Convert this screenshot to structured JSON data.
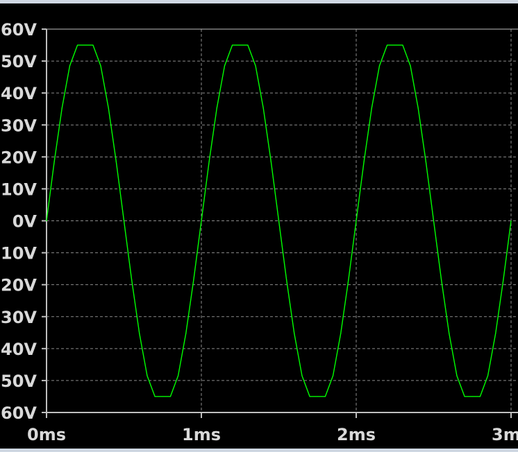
{
  "chart_data": {
    "type": "line",
    "title": "",
    "xlabel": "",
    "ylabel": "",
    "xlim": [
      0,
      3
    ],
    "ylim": [
      -60,
      60
    ],
    "grid": true,
    "x_unit": "ms",
    "y_unit": "V",
    "x_ticks": [
      0,
      1,
      2,
      3
    ],
    "x_tick_labels": [
      "0ms",
      "1ms",
      "2ms",
      "3ms"
    ],
    "y_ticks": [
      60,
      50,
      40,
      30,
      20,
      10,
      0,
      -10,
      -20,
      -30,
      -40,
      -50,
      -60
    ],
    "y_tick_labels": [
      "60V",
      "50V",
      "40V",
      "30V",
      "20V",
      "10V",
      "0V",
      "-10V",
      "-20V",
      "-30V",
      "-40V",
      "-50V",
      "-60V"
    ],
    "series": [
      {
        "color": "#00ff00",
        "x": [
          0,
          0.05,
          0.1,
          0.15,
          0.2,
          0.25,
          0.3,
          0.35,
          0.4,
          0.45,
          0.5,
          0.55,
          0.6,
          0.65,
          0.7,
          0.75,
          0.8,
          0.85,
          0.9,
          0.95,
          1.0,
          1.05,
          1.1,
          1.15,
          1.2,
          1.25,
          1.3,
          1.35,
          1.4,
          1.45,
          1.5,
          1.55,
          1.6,
          1.65,
          1.7,
          1.75,
          1.8,
          1.85,
          1.9,
          1.95,
          2.0,
          2.05,
          2.1,
          2.15,
          2.2,
          2.25,
          2.3,
          2.35,
          2.4,
          2.45,
          2.5,
          2.55,
          2.6,
          2.65,
          2.7,
          2.75,
          2.8,
          2.85,
          2.9,
          2.95,
          3.0
        ],
        "y": [
          0,
          18.5,
          35.3,
          48.5,
          55,
          55,
          55,
          48.5,
          35.3,
          18.5,
          0,
          -18.5,
          -35.3,
          -48.5,
          -55,
          -55,
          -55,
          -48.5,
          -35.3,
          -18.5,
          0,
          18.5,
          35.3,
          48.5,
          55,
          55,
          55,
          48.5,
          35.3,
          18.5,
          0,
          -18.5,
          -35.3,
          -48.5,
          -55,
          -55,
          -55,
          -48.5,
          -35.3,
          -18.5,
          0,
          18.5,
          35.3,
          48.5,
          55,
          55,
          55,
          48.5,
          35.3,
          18.5,
          0,
          -18.5,
          -35.3,
          -48.5,
          -55,
          -55,
          -55,
          -48.5,
          -35.3,
          -18.5,
          0
        ]
      }
    ]
  }
}
